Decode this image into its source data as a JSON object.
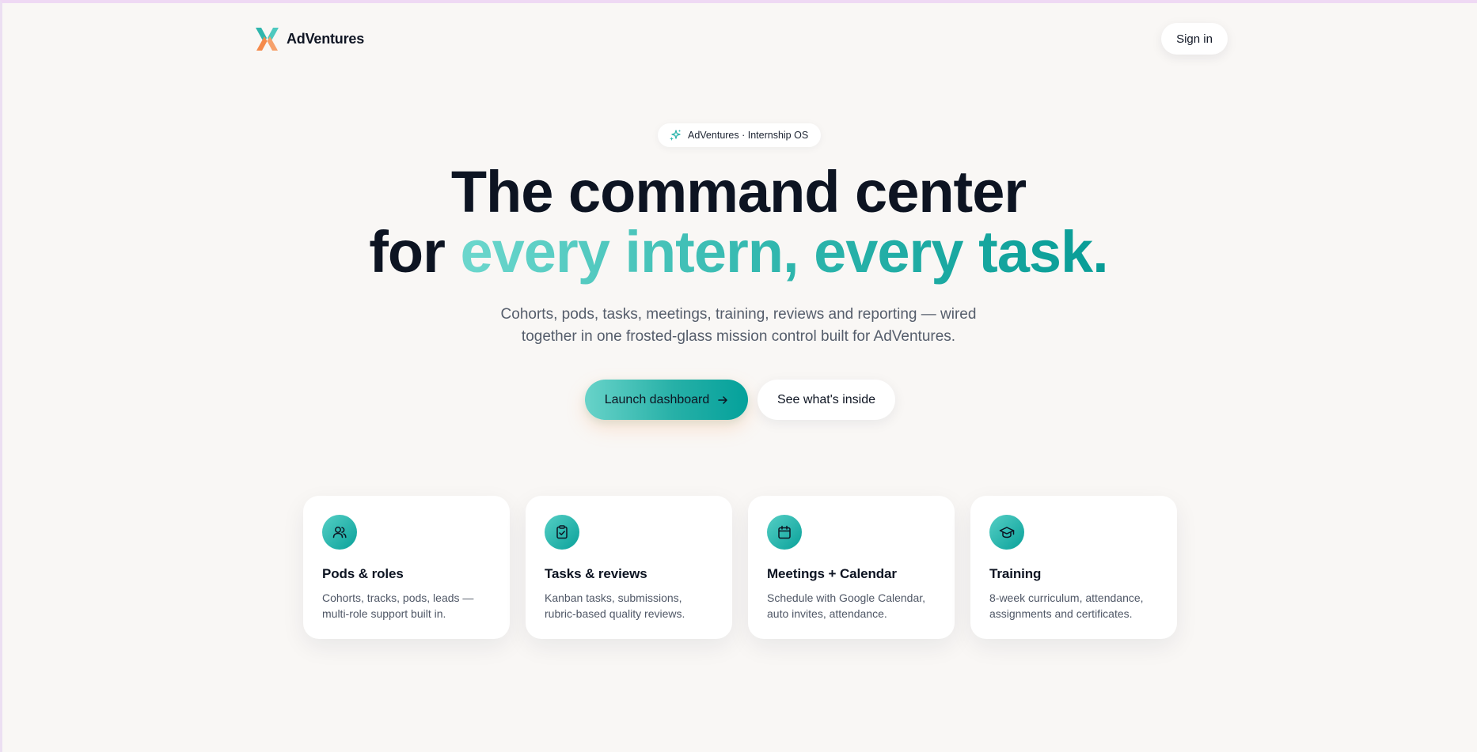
{
  "header": {
    "brand_name": "AdVentures",
    "signin_label": "Sign in"
  },
  "hero": {
    "badge_text": "AdVentures · Internship OS",
    "headline_line1": "The command center",
    "headline_line2_plain": "for ",
    "headline_line2_accent": "every intern, every task.",
    "subtitle_line1": "Cohorts, pods, tasks, meetings, training, reviews and reporting — wired",
    "subtitle_line2": "together in one frosted-glass mission control built for AdVentures.",
    "primary_cta": "Launch dashboard",
    "secondary_cta": "See what's inside"
  },
  "features": [
    {
      "icon": "users-icon",
      "title": "Pods & roles",
      "desc_line1": "Cohorts, tracks, pods, leads —",
      "desc_line2": "multi-role support built in."
    },
    {
      "icon": "clipboard-check-icon",
      "title": "Tasks & reviews",
      "desc_line1": "Kanban tasks, submissions,",
      "desc_line2": "rubric-based quality reviews."
    },
    {
      "icon": "calendar-icon",
      "title": "Meetings + Calendar",
      "desc_line1": "Schedule with Google Calendar,",
      "desc_line2": "auto invites, attendance."
    },
    {
      "icon": "graduation-cap-icon",
      "title": "Training",
      "desc_line1": "8-week curriculum, attendance,",
      "desc_line2": "assignments and certificates."
    }
  ],
  "colors": {
    "background": "#f9f7f5",
    "accent_start": "#6cd7cd",
    "accent_end": "#079c96",
    "logo_orange": "#f58a4b",
    "logo_teal": "#2fb6ad",
    "text_primary": "#0d1422",
    "text_muted": "#555d6b"
  }
}
